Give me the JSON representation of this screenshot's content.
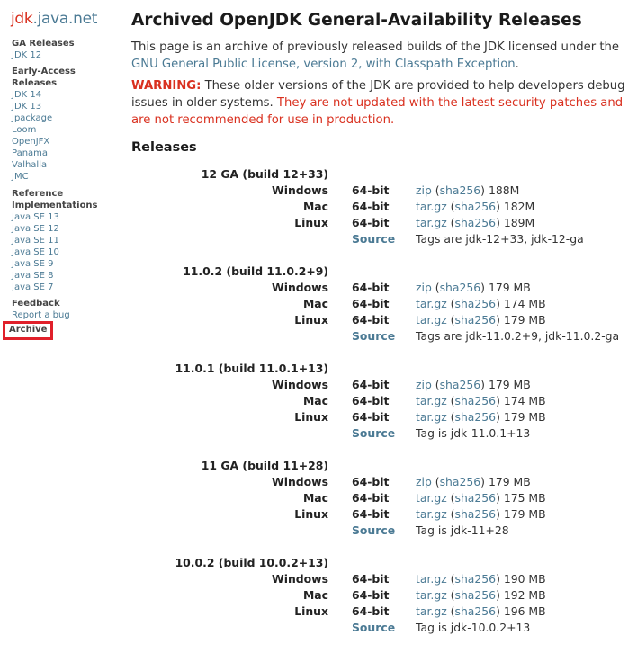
{
  "sidebar": {
    "logo_part1": "jdk",
    "logo_part2": ".java.net",
    "ga_heading": "GA Releases",
    "ga_items": [
      "JDK 12"
    ],
    "ea_heading_1": "Early-Access",
    "ea_heading_2": "Releases",
    "ea_items": [
      "JDK 14",
      "JDK 13",
      "Jpackage",
      "Loom",
      "OpenJFX",
      "Panama",
      "Valhalla",
      "JMC"
    ],
    "ref_heading_1": "Reference",
    "ref_heading_2": "Implementations",
    "ref_items": [
      "Java SE 13",
      "Java SE 12",
      "Java SE 11",
      "Java SE 10",
      "Java SE 9",
      "Java SE 8",
      "Java SE 7"
    ],
    "feedback_heading": "Feedback",
    "feedback_items": [
      "Report a bug"
    ],
    "archive_label": "Archive",
    "highlight_color": "#e0202a"
  },
  "main": {
    "title": "Archived OpenJDK General-Availability Releases",
    "intro_text": "This page is an archive of previously released builds of the JDK licensed under the",
    "intro_link": "GNU General Public License, version 2, with Classpath Exception",
    "intro_end": ".",
    "warning_label": "WARNING:",
    "warning_text": " These older versions of the JDK are provided to help developers debug issues in older systems. ",
    "warning_red": "They are not updated with the latest security patches and are not recommended for use in production.",
    "releases_heading": "Releases",
    "releases": [
      {
        "title": "12 GA (build 12+33)",
        "rows": [
          {
            "os": "Windows",
            "arch": "64-bit",
            "fmt": "zip",
            "sha": "sha256",
            "size": "188M"
          },
          {
            "os": "Mac",
            "arch": "64-bit",
            "fmt": "tar.gz",
            "sha": "sha256",
            "size": "182M"
          },
          {
            "os": "Linux",
            "arch": "64-bit",
            "fmt": "tar.gz",
            "sha": "sha256",
            "size": "189M"
          }
        ],
        "source_label": "Source",
        "tags": "Tags are jdk-12+33, jdk-12-ga"
      },
      {
        "title": "11.0.2 (build 11.0.2+9)",
        "rows": [
          {
            "os": "Windows",
            "arch": "64-bit",
            "fmt": "zip",
            "sha": "sha256",
            "size": "179 MB"
          },
          {
            "os": "Mac",
            "arch": "64-bit",
            "fmt": "tar.gz",
            "sha": "sha256",
            "size": "174 MB"
          },
          {
            "os": "Linux",
            "arch": "64-bit",
            "fmt": "tar.gz",
            "sha": "sha256",
            "size": "179 MB"
          }
        ],
        "source_label": "Source",
        "tags": "Tags are jdk-11.0.2+9, jdk-11.0.2-ga"
      },
      {
        "title": "11.0.1 (build 11.0.1+13)",
        "rows": [
          {
            "os": "Windows",
            "arch": "64-bit",
            "fmt": "zip",
            "sha": "sha256",
            "size": "179 MB"
          },
          {
            "os": "Mac",
            "arch": "64-bit",
            "fmt": "tar.gz",
            "sha": "sha256",
            "size": "174 MB"
          },
          {
            "os": "Linux",
            "arch": "64-bit",
            "fmt": "tar.gz",
            "sha": "sha256",
            "size": "179 MB"
          }
        ],
        "source_label": "Source",
        "tags": "Tag is jdk-11.0.1+13"
      },
      {
        "title": "11 GA (build 11+28)",
        "rows": [
          {
            "os": "Windows",
            "arch": "64-bit",
            "fmt": "zip",
            "sha": "sha256",
            "size": "179 MB"
          },
          {
            "os": "Mac",
            "arch": "64-bit",
            "fmt": "tar.gz",
            "sha": "sha256",
            "size": "175 MB"
          },
          {
            "os": "Linux",
            "arch": "64-bit",
            "fmt": "tar.gz",
            "sha": "sha256",
            "size": "179 MB"
          }
        ],
        "source_label": "Source",
        "tags": "Tag is jdk-11+28"
      },
      {
        "title": "10.0.2 (build 10.0.2+13)",
        "rows": [
          {
            "os": "Windows",
            "arch": "64-bit",
            "fmt": "tar.gz",
            "sha": "sha256",
            "size": "190 MB"
          },
          {
            "os": "Mac",
            "arch": "64-bit",
            "fmt": "tar.gz",
            "sha": "sha256",
            "size": "192 MB"
          },
          {
            "os": "Linux",
            "arch": "64-bit",
            "fmt": "tar.gz",
            "sha": "sha256",
            "size": "196 MB"
          }
        ],
        "source_label": "Source",
        "tags": "Tag is jdk-10.0.2+13"
      }
    ]
  }
}
